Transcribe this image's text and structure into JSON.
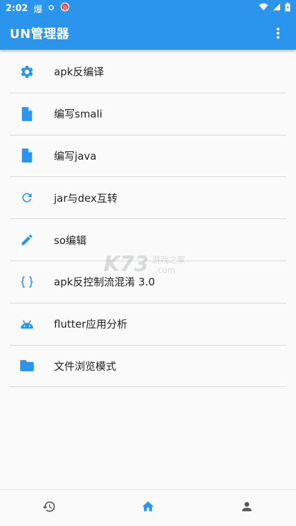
{
  "status_bar": {
    "time": "2:02",
    "notification_glyph": "爆"
  },
  "app_bar": {
    "title": "UN管理器",
    "overflow_icon": "more-vert-icon"
  },
  "accent_color": "#2b95ee",
  "menu": [
    {
      "label": "apk反编译",
      "icon": "gear-icon"
    },
    {
      "label": "编写smali",
      "icon": "document-icon"
    },
    {
      "label": "编写java",
      "icon": "document-icon"
    },
    {
      "label": "jar与dex互转",
      "icon": "refresh-icon"
    },
    {
      "label": "so编辑",
      "icon": "pencil-icon"
    },
    {
      "label": "apk反控制流混淆 3.0",
      "icon": "braces-icon"
    },
    {
      "label": "flutter应用分析",
      "icon": "android-icon"
    },
    {
      "label": "文件浏览模式",
      "icon": "folder-icon"
    }
  ],
  "watermark": {
    "text": "K73",
    "subtext": "游戏之家",
    "domain": ".com"
  },
  "bottom_nav": [
    {
      "icon": "history-icon",
      "active": false
    },
    {
      "icon": "home-icon",
      "active": true
    },
    {
      "icon": "person-icon",
      "active": false
    }
  ]
}
